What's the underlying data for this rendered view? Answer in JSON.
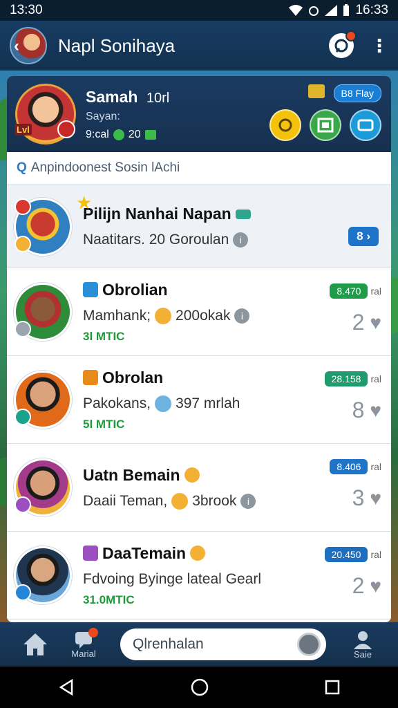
{
  "status_bar": {
    "time_left": "13:30",
    "time_right": "16:33"
  },
  "app_bar": {
    "title": "Napl Sonihaya",
    "notify_icon": "chat-bubble-icon",
    "menu_icon": "kebab-icon"
  },
  "profile": {
    "name": "Samah",
    "name_count": "10rl",
    "subtitle": "Sayan:",
    "stats_left": "9:cal",
    "stats_mid": "20",
    "level_label": "Lvl",
    "play_label": "B8 Flay",
    "actions": [
      "coin-icon",
      "photo-icon",
      "game-icon"
    ]
  },
  "search": {
    "text": "Anpindoonest Sosin lAchi",
    "icon": "search-icon"
  },
  "chats": [
    {
      "title": "Pilijn Nanhai Napan",
      "message": "Naatitars. 20 Goroulan",
      "status": "",
      "time": "8",
      "time_label": "",
      "likes": "",
      "pinned": true
    },
    {
      "title": "Obrolian",
      "message": "Mamhank;",
      "message2": "200okak",
      "status": "3l MTIC",
      "time": "8.470",
      "time_label": "ral",
      "likes": "2"
    },
    {
      "title": "Obrolan",
      "message": "Pakokans,",
      "message2": "397 mrlah",
      "status": "5l MTIC",
      "time": "28.158",
      "time_label": "ral",
      "likes": "8"
    },
    {
      "title": "Uatn Bemain",
      "message": "Daaii Teman,",
      "message2": "3brook",
      "status": "",
      "time": "8.406",
      "time_label": "ral",
      "likes": "3"
    },
    {
      "title": "DaaTemain",
      "message": "Fdvoing Byinge lateal Gearl",
      "message2": "",
      "status": "31.0MTIC",
      "time": "20.450",
      "time_label": "ral",
      "likes": "2"
    }
  ],
  "bottom_nav": {
    "home_icon": "home-icon",
    "messages_label": "Marial",
    "search_placeholder": "Qlrenhalan",
    "profile_label": "Saie"
  },
  "colors": {
    "header": "#173c63",
    "accent": "#1e74c9",
    "status_green": "#1e9a3a"
  }
}
